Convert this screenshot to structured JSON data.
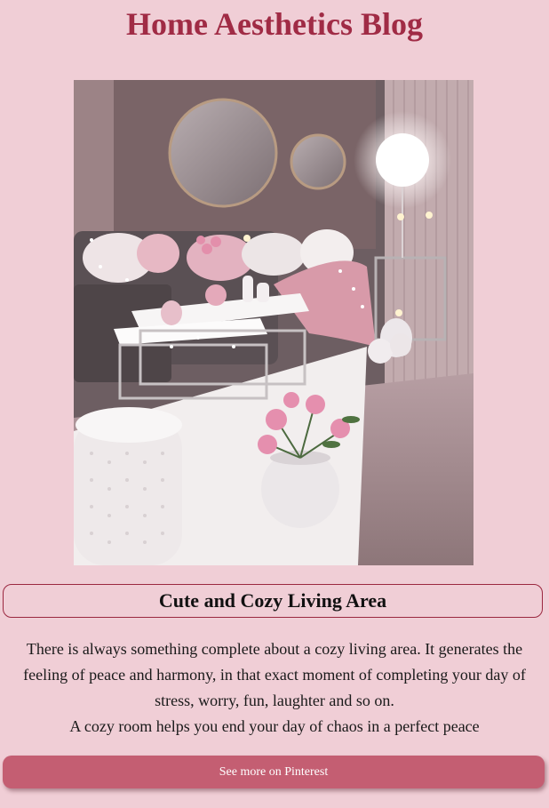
{
  "header": {
    "title": "Home Aesthetics Blog"
  },
  "hero_image": {
    "icon": "living-room-photo",
    "subject": "living-room-photo"
  },
  "post": {
    "title": "Cute and Cozy Living Area",
    "paragraph_1": "There is always something complete about a cozy living area. It generates the feeling of peace and harmony, in that exact moment of completing your day of stress, worry, fun, laughter and so on.",
    "paragraph_2": "A cozy room helps you end your day of chaos in a perfect peace"
  },
  "cta": {
    "label": "See more on Pinterest"
  },
  "colors": {
    "background": "#f0ced6",
    "title": "#a02b45",
    "border": "#9b2840",
    "button": "#c45e72"
  }
}
